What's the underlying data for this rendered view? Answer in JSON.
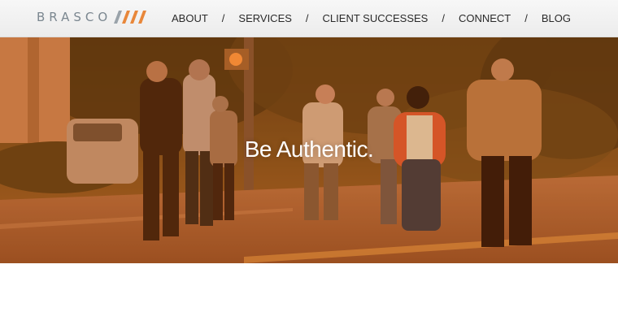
{
  "header": {
    "logo_text": "BRASCO",
    "nav": [
      {
        "label": "ABOUT"
      },
      {
        "label": "SERVICES"
      },
      {
        "label": "CLIENT SUCCESSES"
      },
      {
        "label": "CONNECT"
      },
      {
        "label": "BLOG"
      }
    ],
    "separator": "/"
  },
  "hero": {
    "tagline": "Be Authentic."
  },
  "colors": {
    "logo_gray": "#7b8790",
    "logo_slash_gray": "#9aa3aa",
    "logo_slash_orange": "#e8873a",
    "hero_tint": "#8a4a1c"
  }
}
